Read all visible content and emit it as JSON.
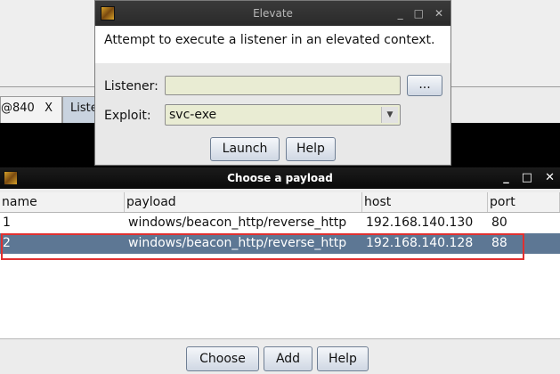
{
  "background": {
    "tabs": [
      {
        "label": "@840",
        "close": "X"
      },
      {
        "label": "Liste"
      }
    ]
  },
  "elevate": {
    "title": "Elevate",
    "controls": {
      "minimize": "_",
      "maximize": "□",
      "close": "✕"
    },
    "description": "Attempt to execute a listener in an elevated context.",
    "listener_label": "Listener:",
    "listener_value": "",
    "browse_label": "...",
    "exploit_label": "Exploit:",
    "exploit_value": "svc-exe",
    "launch_label": "Launch",
    "help_label": "Help"
  },
  "payload_dialog": {
    "title": "Choose a payload",
    "controls": {
      "minimize": "_",
      "maximize": "□",
      "close": "✕"
    },
    "columns": [
      "name",
      "payload",
      "host",
      "port"
    ],
    "rows": [
      {
        "name": "1",
        "payload": "windows/beacon_http/reverse_http",
        "host": "192.168.140.130",
        "port": "80"
      },
      {
        "name": "2",
        "payload": "windows/beacon_http/reverse_http",
        "host": "192.168.140.128",
        "port": "88"
      }
    ],
    "selected_row": 2,
    "choose_label": "Choose",
    "add_label": "Add",
    "help_label": "Help"
  },
  "colors": {
    "selection": "#5d7794",
    "highlight_box": "#e03030"
  }
}
